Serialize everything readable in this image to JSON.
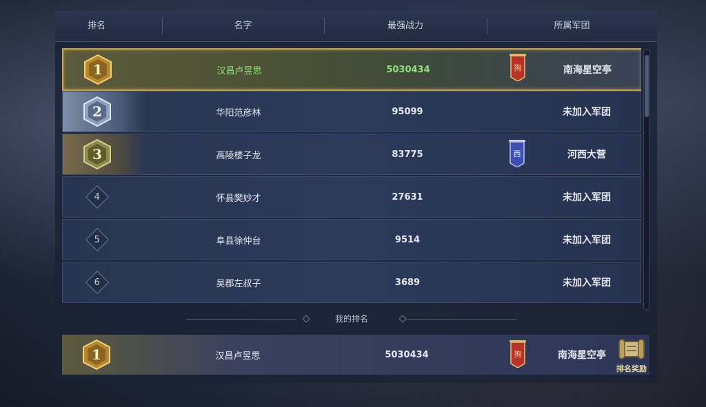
{
  "header": {
    "rank": "排名",
    "name": "名字",
    "power": "最强战力",
    "legion": "所属军团"
  },
  "rows": [
    {
      "rank": "1",
      "name": "汉昌卢昱思",
      "power": "5030434",
      "legion": "南海星空亭",
      "banner_char": "狗",
      "banner": "red"
    },
    {
      "rank": "2",
      "name": "华阳范彦林",
      "power": "95099",
      "legion": "未加入军团"
    },
    {
      "rank": "3",
      "name": "高陵楼子龙",
      "power": "83775",
      "legion": "河西大营",
      "banner_char": "西",
      "banner": "blue"
    },
    {
      "rank": "4",
      "name": "怀县樊妙才",
      "power": "27631",
      "legion": "未加入军团"
    },
    {
      "rank": "5",
      "name": "阜县徐仲台",
      "power": "9514",
      "legion": "未加入军团"
    },
    {
      "rank": "6",
      "name": "吴郡左叔子",
      "power": "3689",
      "legion": "未加入军团"
    }
  ],
  "my_rank_label": "我的排名",
  "my_row": {
    "rank": "1",
    "name": "汉昌卢昱思",
    "power": "5030434",
    "legion": "南海星空亭",
    "banner_char": "狗"
  },
  "reward_label": "排名奖励",
  "colors": {
    "gold": "#c9a545",
    "green_text": "#8fe07a",
    "banner_red": "#b8322a",
    "banner_blue": "#3d4fb0"
  }
}
